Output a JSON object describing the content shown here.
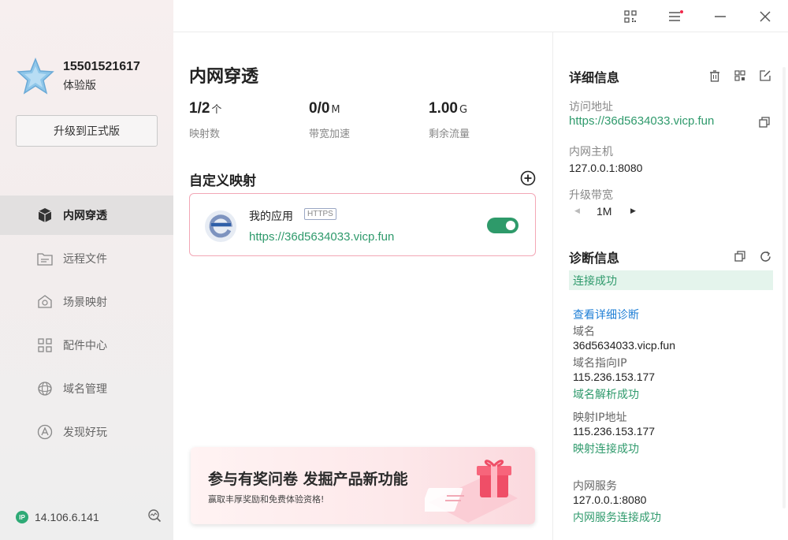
{
  "sidebar": {
    "user": {
      "phone": "15501521617",
      "plan": "体验版"
    },
    "upgrade_label": "升级到正式版",
    "items": [
      {
        "label": "内网穿透",
        "icon": "cube-icon",
        "active": true
      },
      {
        "label": "远程文件",
        "icon": "folder-icon",
        "active": false
      },
      {
        "label": "场景映射",
        "icon": "scene-icon",
        "active": false
      },
      {
        "label": "配件中心",
        "icon": "grid-icon",
        "active": false
      },
      {
        "label": "域名管理",
        "icon": "domain-icon",
        "active": false
      },
      {
        "label": "发现好玩",
        "icon": "discover-icon",
        "active": false
      }
    ],
    "footer": {
      "ip_badge": "IP",
      "ip": "14.106.6.141"
    }
  },
  "titlebar": {
    "icons": [
      "qrcode-icon",
      "menu-icon",
      "minimize-icon",
      "close-icon"
    ],
    "notification_color": "#f0284a"
  },
  "main": {
    "title": "内网穿透",
    "stats": [
      {
        "value": "1/2",
        "unit": "个",
        "label": "映射数"
      },
      {
        "value": "0/0",
        "unit": "M",
        "label": "带宽加速"
      },
      {
        "value": "1.00",
        "unit": "G",
        "label": "剩余流量"
      }
    ],
    "custom_mapping": {
      "title": "自定义映射",
      "apps": [
        {
          "name": "我的应用",
          "tag": "HTTPS",
          "url": "https://36d5634033.vicp.fun",
          "enabled": true
        }
      ]
    },
    "banner": {
      "title": "参与有奖问卷 发掘产品新功能",
      "subtitle": "赢取丰厚奖励和免费体验资格!"
    }
  },
  "details": {
    "title": "详细信息",
    "access_label": "访问地址",
    "access_url": "https://36d5634033.vicp.fun",
    "host_label": "内网主机",
    "host_value": "127.0.0.1:8080",
    "bandwidth_label": "升级带宽",
    "bandwidth_value": "1M"
  },
  "diagnostics": {
    "title": "诊断信息",
    "status": "连接成功",
    "detail_link": "查看详细诊断",
    "domain_label": "域名",
    "domain_value": "36d5634033.vicp.fun",
    "domain_ip_label": "域名指向IP",
    "domain_ip_value": "115.236.153.177",
    "domain_ok": "域名解析成功",
    "map_ip_label": "映射IP地址",
    "map_ip_value": "115.236.153.177",
    "map_ok": "映射连接成功",
    "service_label": "内网服务",
    "service_value": "127.0.0.1:8080",
    "service_ok": "内网服务连接成功"
  },
  "colors": {
    "accent_green": "#2f9a6c",
    "link_blue": "#1f7fd6",
    "card_border": "#f3a7b6"
  }
}
